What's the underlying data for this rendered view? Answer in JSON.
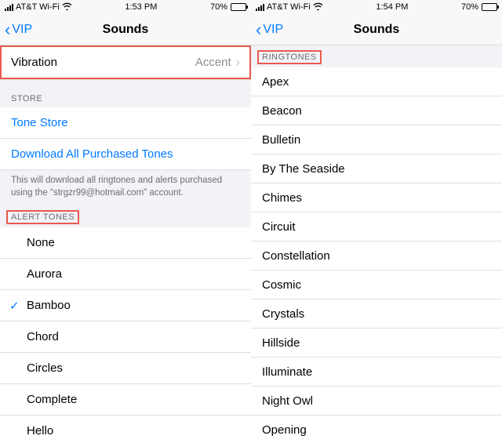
{
  "left": {
    "status": {
      "carrier": "AT&T Wi-Fi",
      "time": "1:53 PM",
      "battery_pct": "70%"
    },
    "nav": {
      "back": "VIP",
      "title": "Sounds"
    },
    "vibration": {
      "label": "Vibration",
      "value": "Accent"
    },
    "store_header": "STORE",
    "store_links": {
      "tone_store": "Tone Store",
      "download_all": "Download All Purchased Tones"
    },
    "download_note": "This will download all ringtones and alerts purchased using the \"strgzr99@hotmail.com\" account.",
    "alert_tones_header": "ALERT TONES",
    "alert_tones": [
      "None",
      "Aurora",
      "Bamboo",
      "Chord",
      "Circles",
      "Complete",
      "Hello"
    ],
    "selected_tone": "Bamboo"
  },
  "right": {
    "status": {
      "carrier": "AT&T Wi-Fi",
      "time": "1:54 PM",
      "battery_pct": "70%"
    },
    "nav": {
      "back": "VIP",
      "title": "Sounds"
    },
    "ringtones_header": "RINGTONES",
    "ringtones": [
      "Apex",
      "Beacon",
      "Bulletin",
      "By The Seaside",
      "Chimes",
      "Circuit",
      "Constellation",
      "Cosmic",
      "Crystals",
      "Hillside",
      "Illuminate",
      "Night Owl",
      "Opening"
    ]
  }
}
